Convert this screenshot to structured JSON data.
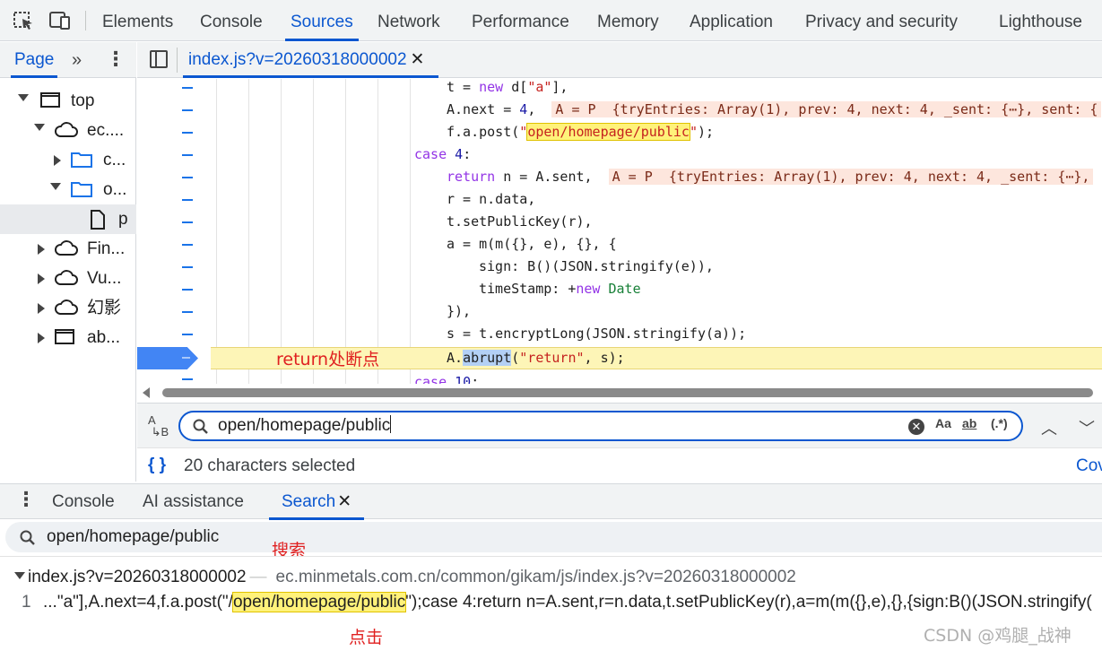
{
  "toolbar": {
    "tabs": [
      "Elements",
      "Console",
      "Sources",
      "Network",
      "Performance",
      "Memory",
      "Application",
      "Privacy and security",
      "Lighthouse"
    ],
    "active_tab": "Sources"
  },
  "navigator": {
    "tab_label": "Page",
    "items": [
      {
        "label": "top",
        "icon": "frame-icon",
        "expanded": true
      },
      {
        "label": "ec....",
        "icon": "cloud-icon",
        "expanded": true
      },
      {
        "label": "c...",
        "icon": "folder-icon",
        "expanded": false
      },
      {
        "label": "o...",
        "icon": "folder-icon",
        "expanded": true
      },
      {
        "label": "p",
        "icon": "file-icon",
        "selected": true
      },
      {
        "label": "Fin...",
        "icon": "cloud-icon",
        "expanded": false
      },
      {
        "label": "Vu...",
        "icon": "cloud-icon",
        "expanded": false
      },
      {
        "label": "幻影",
        "icon": "cloud-icon",
        "expanded": false
      },
      {
        "label": "ab...",
        "icon": "frame-icon",
        "expanded": false
      }
    ]
  },
  "editor": {
    "file_tab": "index.js?v=20260318000002",
    "lines": {
      "l1_a": "t = ",
      "l1_kw": "new",
      "l1_b": " d[",
      "l1_str": "\"a\"",
      "l1_c": "],",
      "l2_a": "A.next = ",
      "l2_num": "4",
      "l2_b": ",",
      "l2_inline": "A = P  {tryEntries: Array(1), prev: 4, next: 4, _sent: {⋯}, sent: {",
      "l3_a": "f.a.post(",
      "l3_q1": "\"",
      "l3_hl": "open/homepage/public",
      "l3_q2": "\"",
      "l3_b": ");",
      "l4_kw": "case",
      "l4_num": " 4",
      "l4_b": ":",
      "l5_kw": "return",
      "l5_a": " n = A.sent,",
      "l5_inline": "A = P  {tryEntries: Array(1), prev: 4, next: 4, _sent: {⋯},",
      "l6": "r = n.data,",
      "l7": "t.setPublicKey(r),",
      "l8": "a = m(m({}, e), {}, {",
      "l9": "sign: B()(JSON.stringify(e)),",
      "l10_a": "timeStamp: +",
      "l10_kw": "new",
      "l10_cls": " Date",
      "l11": "}),",
      "l12": "s = t.encryptLong(JSON.stringify(a));",
      "l13_a": "A.",
      "l13_sel": "abrupt",
      "l13_b": "(",
      "l13_str": "\"return\"",
      "l13_c": ", s);",
      "l14_kw": "case",
      "l14_num": " 10",
      "l14_b": ":"
    },
    "breakpoint_marker": "–",
    "annotation_breakpoint": "return处断点"
  },
  "find": {
    "query": "open/homepage/public",
    "opt_case": "Aa",
    "opt_word": "ab",
    "opt_regex": "(.*)"
  },
  "status": {
    "selection": "20 characters selected",
    "coverage": "Cov"
  },
  "drawer": {
    "tabs": [
      "Console",
      "AI assistance",
      "Search"
    ],
    "active_tab": "Search",
    "search_query": "open/homepage/public",
    "annotation_search": "搜索",
    "result_file": "index.js?v=20260318000002",
    "result_path": "ec.minmetals.com.cn/common/gikam/js/index.js?v=20260318000002",
    "result_line_no": "1",
    "result_pre": "...\"a\"],A.next=4,f.a.post(\"/",
    "result_match": "open/homepage/public",
    "result_post": "\");case 4:return n=A.sent,r=n.data,t.setPublicKey(r),a=m(m({},e),{},{sign:B()(JSON.stringify(",
    "annotation_click": "点击"
  },
  "watermark": "CSDN @鸡腿_战神",
  "colors": {
    "accent": "#0b57d0",
    "annotation": "#e02020",
    "breakpoint": "#4285f4",
    "highlight": "#fff27a"
  }
}
